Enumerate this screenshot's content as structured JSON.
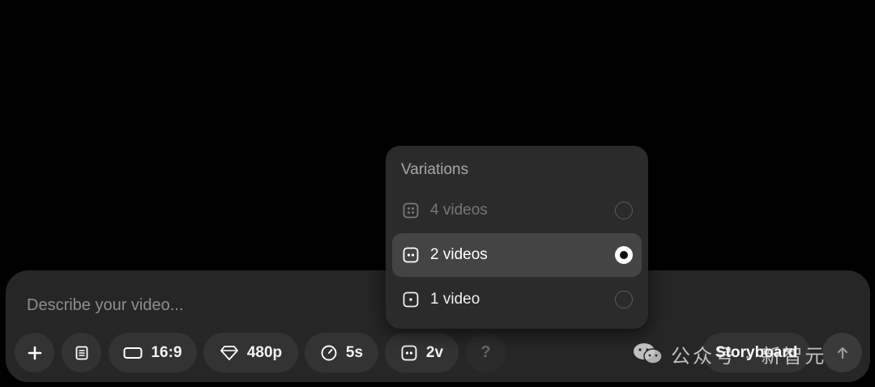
{
  "composer": {
    "placeholder": "Describe your video...",
    "toolbar": {
      "aspect_ratio": "16:9",
      "resolution": "480p",
      "duration": "5s",
      "variations": "2v",
      "help": "?",
      "storyboard": "Storyboard"
    }
  },
  "variations_menu": {
    "title": "Variations",
    "options": [
      {
        "label": "4 videos",
        "selected": false,
        "disabled": true
      },
      {
        "label": "2 videos",
        "selected": true,
        "disabled": false
      },
      {
        "label": "1 video",
        "selected": false,
        "disabled": false
      }
    ]
  },
  "watermark": {
    "text": "公众号 · 新智元"
  },
  "icons": {
    "add": "plus-icon",
    "presets": "document-icon",
    "aspect": "rectangle-icon",
    "quality": "diamond-icon",
    "duration": "clock-icon",
    "variations": "two-dots-icon",
    "submit": "arrow-up-icon"
  },
  "colors": {
    "background": "#000000",
    "panel": "#262626",
    "chip": "#333333",
    "menu": "#2b2b2b",
    "menu_selected": "#444444"
  }
}
